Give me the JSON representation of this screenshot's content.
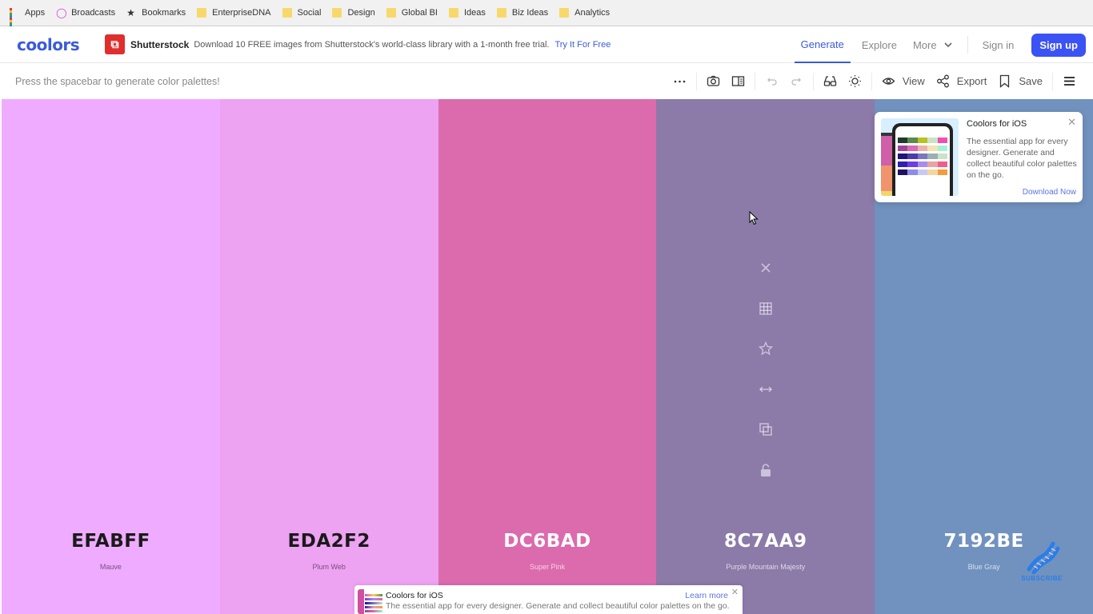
{
  "bookmarks": [
    {
      "label": "Apps",
      "icon": "apps-grid-icon"
    },
    {
      "label": "Broadcasts",
      "icon": "broadcast-icon"
    },
    {
      "label": "Bookmarks",
      "icon": "star-icon"
    },
    {
      "label": "EnterpriseDNA",
      "icon": "folder-icon"
    },
    {
      "label": "Social",
      "icon": "folder-icon"
    },
    {
      "label": "Design",
      "icon": "folder-icon"
    },
    {
      "label": "Global BI",
      "icon": "folder-icon"
    },
    {
      "label": "Ideas",
      "icon": "folder-icon"
    },
    {
      "label": "Biz Ideas",
      "icon": "folder-icon"
    },
    {
      "label": "Analytics",
      "icon": "folder-icon"
    }
  ],
  "navbar": {
    "logo": "coolors",
    "ad": {
      "brand": "Shutterstock",
      "text": "Download 10 FREE images from Shutterstock's world-class library with a 1-month free trial.",
      "link": "Try It For Free"
    },
    "items": [
      "Generate",
      "Explore",
      "More"
    ],
    "active": "Generate",
    "signin": "Sign in",
    "signup": "Sign up",
    "accent": "#3b52f5"
  },
  "toolbar": {
    "hint": "Press the spacebar to generate color palettes!",
    "view_label": "View",
    "export_label": "Export",
    "save_label": "Save"
  },
  "palette": [
    {
      "hex": "EFABFF",
      "name": "Mauve",
      "color": "#EFABFF",
      "text": "dark"
    },
    {
      "hex": "EDA2F2",
      "name": "Plum Web",
      "color": "#EDA2F2",
      "text": "dark"
    },
    {
      "hex": "DC6BAD",
      "name": "Super Pink",
      "color": "#DC6BAD",
      "text": "light"
    },
    {
      "hex": "8C7AA9",
      "name": "Purple Mountain Majesty",
      "color": "#8C7AA9",
      "text": "light"
    },
    {
      "hex": "7192BE",
      "name": "Blue Gray",
      "color": "#7192BE",
      "text": "light"
    }
  ],
  "swatch_tools": [
    "close-icon",
    "grid-icon",
    "star-icon",
    "drag-arrows-icon",
    "copy-icon",
    "unlock-icon"
  ],
  "ios_card": {
    "title": "Coolors for iOS",
    "description": "The essential app for every designer. Generate and collect beautiful color palettes on the go.",
    "link": "Download Now"
  },
  "bottom_ad": {
    "title": "Coolors for iOS",
    "description": "The essential app for every designer. Generate and collect beautiful color palettes on the go.",
    "link": "Learn more"
  },
  "subscribe": {
    "label": "SUBSCRIBE"
  }
}
